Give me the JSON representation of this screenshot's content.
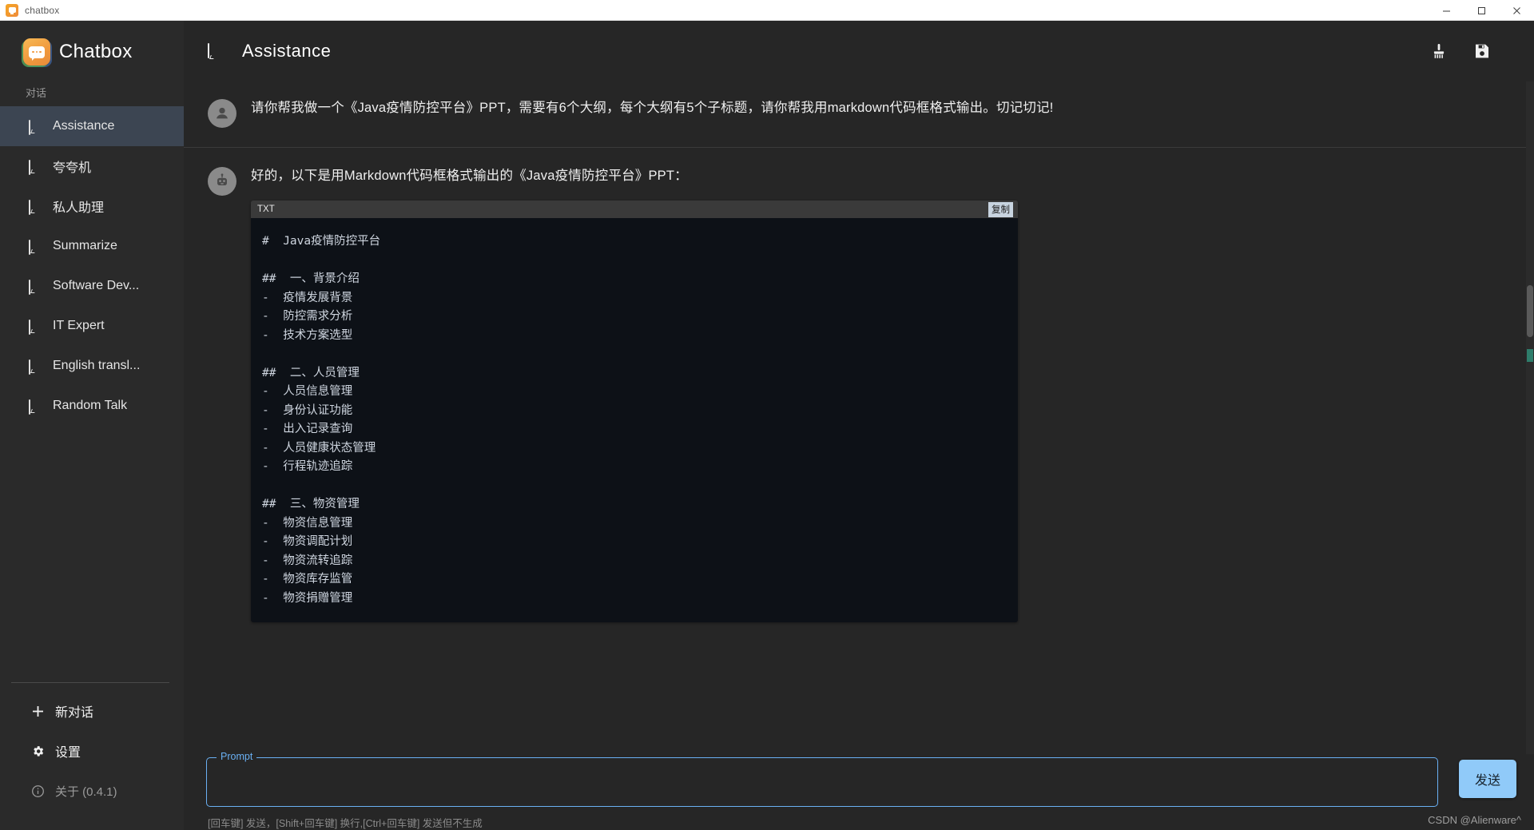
{
  "window": {
    "title": "chatbox",
    "icon": "chatbox-app-icon",
    "minimize_label": "─",
    "maximize_label": "❐",
    "close_label": "✕"
  },
  "sidebar": {
    "brand": "Chatbox",
    "brand_icon": "chatbox-logo-icon",
    "section_label": "对话",
    "items": [
      {
        "label": "Assistance",
        "icon": "chat-bubble-icon",
        "active": true
      },
      {
        "label": "夸夸机",
        "icon": "chat-bubble-icon",
        "active": false
      },
      {
        "label": "私人助理",
        "icon": "chat-bubble-icon",
        "active": false
      },
      {
        "label": "Summarize",
        "icon": "chat-bubble-icon",
        "active": false
      },
      {
        "label": "Software Dev...",
        "icon": "chat-bubble-icon",
        "active": false
      },
      {
        "label": "IT Expert",
        "icon": "chat-bubble-icon",
        "active": false
      },
      {
        "label": "English transl...",
        "icon": "chat-bubble-icon",
        "active": false
      },
      {
        "label": "Random Talk",
        "icon": "chat-bubble-icon",
        "active": false
      }
    ],
    "footer": {
      "new_chat": "新对话",
      "new_chat_icon": "plus-icon",
      "settings": "设置",
      "settings_icon": "gear-icon",
      "about": "关于 (0.4.1)",
      "about_icon": "info-circle-icon"
    }
  },
  "header": {
    "title": "Assistance",
    "title_icon": "chat-bubble-icon",
    "clean_icon": "broom-icon",
    "save_icon": "floppy-disk-save-icon"
  },
  "messages": [
    {
      "role": "user",
      "avatar_icon": "user-avatar-icon",
      "text": "请你帮我做一个《Java疫情防控平台》PPT，需要有6个大纲，每个大纲有5个子标题，请你帮我用markdown代码框格式输出。切记切记!"
    },
    {
      "role": "assistant",
      "avatar_icon": "bot-avatar-icon",
      "text": "好的，以下是用Markdown代码框格式输出的《Java疫情防控平台》PPT："
    }
  ],
  "codeblock": {
    "language_label": "TXT",
    "copy_label": "复制",
    "content": "#  Java疫情防控平台\n\n##  一、背景介绍\n-  疫情发展背景\n-  防控需求分析\n-  技术方案选型\n\n##  二、人员管理\n-  人员信息管理\n-  身份认证功能\n-  出入记录查询\n-  人员健康状态管理\n-  行程轨迹追踪\n\n##  三、物资管理\n-  物资信息管理\n-  物资调配计划\n-  物资流转追踪\n-  物资库存监管\n-  物资捐赠管理"
  },
  "composer": {
    "legend": "Prompt",
    "value": "",
    "placeholder": "",
    "hint": "[回车键] 发送，[Shift+回车键] 换行,[Ctrl+回车键] 发送但不生成",
    "send_label": "发送"
  },
  "watermark": "CSDN @Alienware^",
  "colors": {
    "accent": "#6ab0f3",
    "send_button": "#90caf9",
    "sidebar_bg": "#2a2a2a",
    "main_bg": "#262626",
    "active_item": "#3c4552",
    "code_bg": "#0d1117",
    "code_head_bg": "#3a3a3a"
  }
}
